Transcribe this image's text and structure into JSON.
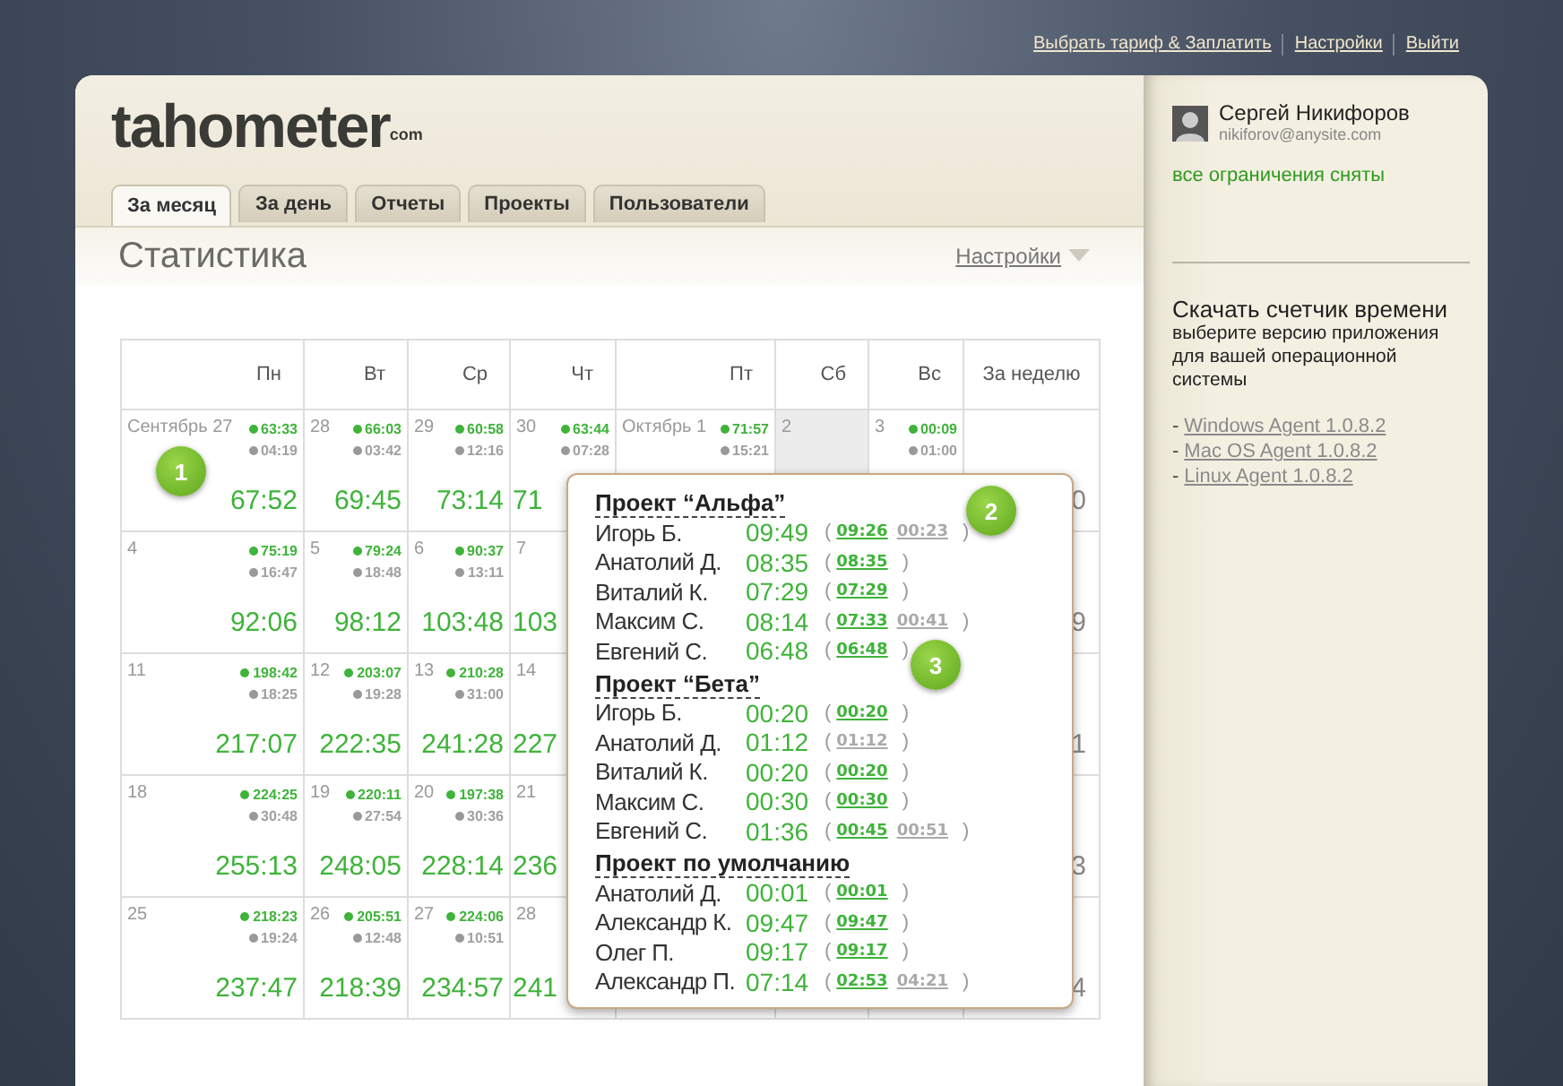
{
  "top_links": [
    "Выбрать тариф & Заплатить",
    "Настройки",
    "Выйти"
  ],
  "logo": {
    "name": "tahometer",
    "suffix": "com"
  },
  "tabs": [
    {
      "label": "За месяц",
      "selected": true
    },
    {
      "label": "За день",
      "selected": false
    },
    {
      "label": "Отчеты",
      "selected": false
    },
    {
      "label": "Проекты",
      "selected": false
    },
    {
      "label": "Пользователи",
      "selected": false
    }
  ],
  "page_title": "Статистика",
  "settings_link": "Настройки",
  "calendar": {
    "columns": [
      "Пн",
      "Вт",
      "Ср",
      "Чт",
      "Пт",
      "Сб",
      "Вс",
      "За неделю"
    ],
    "rows": [
      {
        "cells": [
          {
            "day": "Сентябрь 27",
            "active": "63:33",
            "idle": "04:19",
            "total": "67:52",
            "shaded": false
          },
          {
            "day": "28",
            "active": "66:03",
            "idle": "03:42",
            "total": "69:45",
            "shaded": false
          },
          {
            "day": "29",
            "active": "60:58",
            "idle": "12:16",
            "total": "73:14",
            "shaded": false
          },
          {
            "day": "30",
            "active": "63:44",
            "idle": "07:28",
            "total": "71",
            "shaded": false
          },
          {
            "day": "Октябрь 1",
            "active": "71:57",
            "idle": "15:21",
            "shaded": false
          },
          {
            "day": "2",
            "shaded": true
          },
          {
            "day": "3",
            "active": "00:09",
            "idle": "01:00",
            "shaded": false
          }
        ],
        "week_total": "0"
      },
      {
        "cells": [
          {
            "day": "4",
            "active": "75:19",
            "idle": "16:47",
            "total": "92:06",
            "shaded": false
          },
          {
            "day": "5",
            "active": "79:24",
            "idle": "18:48",
            "total": "98:12",
            "shaded": false
          },
          {
            "day": "6",
            "active": "90:37",
            "idle": "13:11",
            "total": "103:48",
            "shaded": false
          },
          {
            "day": "7",
            "total": "103",
            "shaded": false
          }
        ],
        "week_total": "9"
      },
      {
        "cells": [
          {
            "day": "11",
            "active": "198:42",
            "idle": "18:25",
            "total": "217:07",
            "shaded": false
          },
          {
            "day": "12",
            "active": "203:07",
            "idle": "19:28",
            "total": "222:35",
            "shaded": false
          },
          {
            "day": "13",
            "active": "210:28",
            "idle": "31:00",
            "total": "241:28",
            "shaded": false
          },
          {
            "day": "14",
            "total": "227",
            "shaded": false
          }
        ],
        "week_total": "1"
      },
      {
        "cells": [
          {
            "day": "18",
            "active": "224:25",
            "idle": "30:48",
            "total": "255:13",
            "shaded": false
          },
          {
            "day": "19",
            "active": "220:11",
            "idle": "27:54",
            "total": "248:05",
            "shaded": false
          },
          {
            "day": "20",
            "active": "197:38",
            "idle": "30:36",
            "total": "228:14",
            "shaded": false
          },
          {
            "day": "21",
            "total": "236",
            "shaded": false
          }
        ],
        "week_total": "3"
      },
      {
        "cells": [
          {
            "day": "25",
            "active": "218:23",
            "idle": "19:24",
            "total": "237:47",
            "shaded": false
          },
          {
            "day": "26",
            "active": "205:51",
            "idle": "12:48",
            "total": "218:39",
            "shaded": false
          },
          {
            "day": "27",
            "active": "224:06",
            "idle": "10:51",
            "total": "234:57",
            "shaded": false
          },
          {
            "day": "28",
            "total": "241",
            "shaded": false
          }
        ],
        "week_total": "4"
      }
    ]
  },
  "popup": {
    "projects": [
      {
        "name": "Проект “Альфа”",
        "users": [
          {
            "name": "Игорь Б.",
            "total": "09:49",
            "open": "(",
            "parts": [
              {
                "kind": "active",
                "value": "09:26"
              },
              {
                "kind": "idle",
                "value": "00:23"
              }
            ],
            "close": ")"
          },
          {
            "name": "Анатолий Д.",
            "total": "08:35",
            "open": "(",
            "parts": [
              {
                "kind": "active",
                "value": "08:35"
              }
            ],
            "close": ")"
          },
          {
            "name": "Виталий К.",
            "total": "07:29",
            "open": "(",
            "parts": [
              {
                "kind": "active",
                "value": "07:29"
              }
            ],
            "close": ")"
          },
          {
            "name": "Максим С.",
            "total": "08:14",
            "open": "(",
            "parts": [
              {
                "kind": "active",
                "value": "07:33"
              },
              {
                "kind": "idle",
                "value": "00:41"
              }
            ],
            "close": ")"
          },
          {
            "name": "Евгений С.",
            "total": "06:48",
            "open": "(",
            "parts": [
              {
                "kind": "active",
                "value": "06:48"
              }
            ],
            "close": ")"
          }
        ]
      },
      {
        "name": "Проект “Бета”",
        "users": [
          {
            "name": "Игорь Б.",
            "total": "00:20",
            "open": "(",
            "parts": [
              {
                "kind": "active",
                "value": "00:20"
              }
            ],
            "close": ")"
          },
          {
            "name": "Анатолий Д.",
            "total": "01:12",
            "open": "(",
            "parts": [
              {
                "kind": "idle",
                "value": "01:12"
              }
            ],
            "close": ")"
          },
          {
            "name": "Виталий К.",
            "total": "00:20",
            "open": "(",
            "parts": [
              {
                "kind": "active",
                "value": "00:20"
              }
            ],
            "close": ")"
          },
          {
            "name": "Максим С.",
            "total": "00:30",
            "open": "(",
            "parts": [
              {
                "kind": "active",
                "value": "00:30"
              }
            ],
            "close": ")"
          },
          {
            "name": "Евгений С.",
            "total": "01:36",
            "open": "(",
            "parts": [
              {
                "kind": "active",
                "value": "00:45"
              },
              {
                "kind": "idle",
                "value": "00:51"
              }
            ],
            "close": ")"
          }
        ]
      },
      {
        "name": "Проект по умолчанию",
        "users": [
          {
            "name": "Анатолий Д.",
            "total": "00:01",
            "open": "(",
            "parts": [
              {
                "kind": "active",
                "value": "00:01"
              }
            ],
            "close": ")"
          },
          {
            "name": "Александр К.",
            "total": "09:47",
            "open": "(",
            "parts": [
              {
                "kind": "active",
                "value": "09:47"
              }
            ],
            "close": ")"
          },
          {
            "name": "Олег П.",
            "total": "09:17",
            "open": "(",
            "parts": [
              {
                "kind": "active",
                "value": "09:17"
              }
            ],
            "close": ")"
          },
          {
            "name": "Александр П.",
            "total": "07:14",
            "open": "(",
            "parts": [
              {
                "kind": "active",
                "value": "02:53"
              },
              {
                "kind": "idle",
                "value": "04:21"
              }
            ],
            "close": ")"
          }
        ]
      }
    ]
  },
  "markers": [
    "1",
    "2",
    "3"
  ],
  "sidebar": {
    "user_name": "Сергей Никифоров",
    "email": "nikiforov@anysite.com",
    "status": "все ограничения сняты",
    "download_title": "Скачать счетчик времени",
    "download_hint": "выберите версию приложения для вашей операционной системы",
    "agents": [
      {
        "dash": "-",
        "label": "Windows Agent 1.0.8.2"
      },
      {
        "dash": "-",
        "label": "Mac OS Agent 1.0.8.2"
      },
      {
        "dash": "-",
        "label": "Linux Agent 1.0.8.2"
      }
    ]
  }
}
